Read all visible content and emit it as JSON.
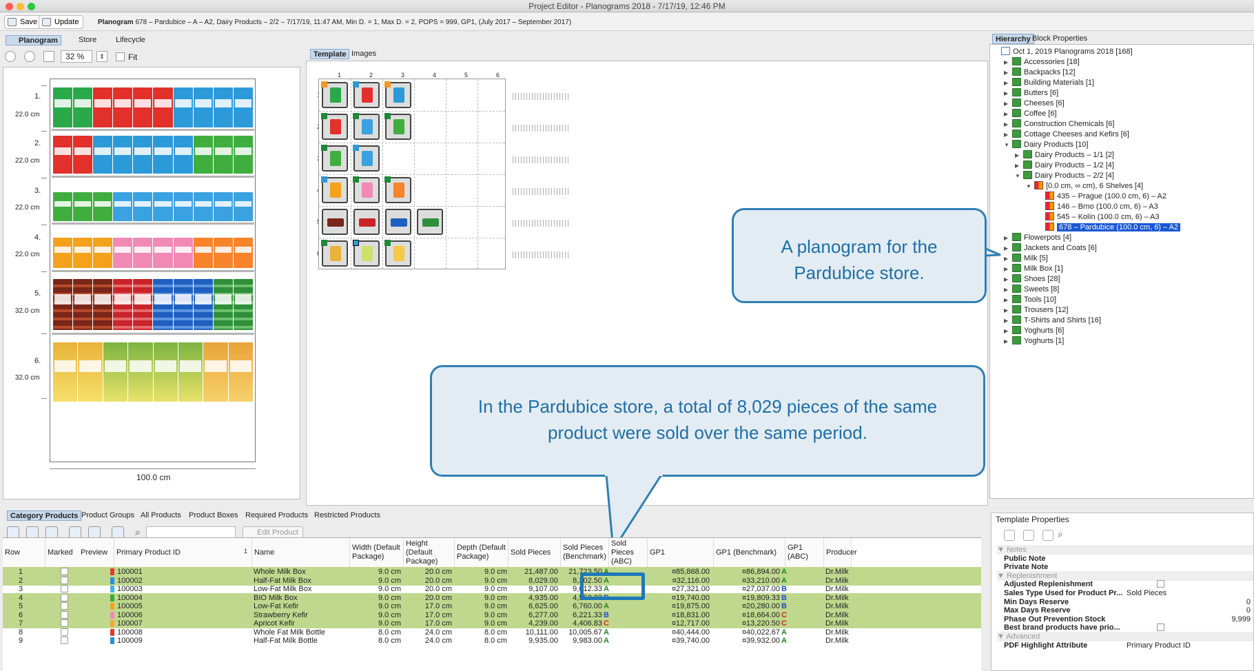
{
  "window": {
    "title": "Project Editor - Planograms 2018 - 7/17/19, 12:46 PM"
  },
  "toolbar": {
    "save_label": "Save",
    "update_label": "Update",
    "info_prefix": "Planogram",
    "info_text": "678 – Pardubice – A – A2, Dairy Products – 2/2 – 7/17/19, 11:47 AM, Min D. = 1, Max D. = 2, POPS = 999, GP1, (July 2017 – September 2017)"
  },
  "left_tabs": [
    "Planogram",
    "Store",
    "Lifecycle"
  ],
  "zoom": {
    "value": "32 %",
    "fit_label": "Fit"
  },
  "planogram": {
    "shelves": [
      {
        "num": "1.",
        "height": "22.0 cm"
      },
      {
        "num": "2.",
        "height": "22.0 cm"
      },
      {
        "num": "3.",
        "height": "22.0 cm"
      },
      {
        "num": "4.",
        "height": "22.0 cm"
      },
      {
        "num": "5.",
        "height": "32.0 cm"
      },
      {
        "num": "6.",
        "height": "32.0 cm"
      }
    ],
    "width_label": "100.0 cm"
  },
  "template_tabs": [
    "Template",
    "Images"
  ],
  "template_grid": {
    "cols": [
      "1",
      "2",
      "3",
      "4",
      "5",
      "6"
    ],
    "rows": [
      "1",
      "2",
      "3",
      "4",
      "5",
      "6"
    ]
  },
  "hierarchy_tabs": [
    "Hierarchy",
    "Block Properties"
  ],
  "tree": [
    {
      "label": "Oct 1, 2019 Planograms 2018 [168]",
      "level": 0,
      "type": "root"
    },
    {
      "label": "Accessories [18]",
      "level": 1,
      "type": "folder"
    },
    {
      "label": "Backpacks [12]",
      "level": 1,
      "type": "folder"
    },
    {
      "label": "Building Materials [1]",
      "level": 1,
      "type": "folder"
    },
    {
      "label": "Butters [6]",
      "level": 1,
      "type": "folder"
    },
    {
      "label": "Cheeses [6]",
      "level": 1,
      "type": "folder"
    },
    {
      "label": "Coffee [6]",
      "level": 1,
      "type": "folder"
    },
    {
      "label": "Construction Chemicals [6]",
      "level": 1,
      "type": "folder"
    },
    {
      "label": "Cottage Cheeses and Kefirs [6]",
      "level": 1,
      "type": "folder"
    },
    {
      "label": "Dairy Products [10]",
      "level": 1,
      "type": "folder",
      "open": true
    },
    {
      "label": "Dairy Products – 1/1 [2]",
      "level": 2,
      "type": "folder"
    },
    {
      "label": "Dairy Products – 1/2 [4]",
      "level": 2,
      "type": "folder"
    },
    {
      "label": "Dairy Products – 2/2 [4]",
      "level": 2,
      "type": "folder",
      "open": true
    },
    {
      "label": "[0.0 cm, ∞ cm), 6 Shelves [4]",
      "level": 3,
      "type": "plano",
      "open": true
    },
    {
      "label": "435 – Prague (100.0 cm, 6) – A2",
      "level": 4,
      "type": "plano"
    },
    {
      "label": "146 – Brno (100.0 cm, 6) – A3",
      "level": 4,
      "type": "plano"
    },
    {
      "label": "545 – Kolín (100.0 cm, 6) – A3",
      "level": 4,
      "type": "plano"
    },
    {
      "label": "678 – Pardubice  (100.0 cm, 6) – A2",
      "level": 4,
      "type": "plano",
      "selected": true
    },
    {
      "label": "Flowerpots [4]",
      "level": 1,
      "type": "folder"
    },
    {
      "label": "Jackets and Coats [6]",
      "level": 1,
      "type": "folder"
    },
    {
      "label": "Milk [5]",
      "level": 1,
      "type": "folder"
    },
    {
      "label": "Milk Box [1]",
      "level": 1,
      "type": "folder"
    },
    {
      "label": "Shoes [28]",
      "level": 1,
      "type": "folder"
    },
    {
      "label": "Sweets [8]",
      "level": 1,
      "type": "folder"
    },
    {
      "label": "Tools [10]",
      "level": 1,
      "type": "folder"
    },
    {
      "label": "Trousers [12]",
      "level": 1,
      "type": "folder"
    },
    {
      "label": "T-Shirts and Shirts [16]",
      "level": 1,
      "type": "folder"
    },
    {
      "label": "Yoghurts [6]",
      "level": 1,
      "type": "folder"
    },
    {
      "label": "Yoghurts [1]",
      "level": 1,
      "type": "folder"
    }
  ],
  "callouts": {
    "top": "A planogram for the Pardubice store.",
    "bottom": "In the Pardubice store, a total of 8,029 pieces of the same product were sold over the same period."
  },
  "bottom_tabs": [
    "Category Products",
    "Product Groups",
    "All Products",
    "Product Boxes",
    "Required Products",
    "Restricted Products"
  ],
  "edit_product_label": "Edit Product",
  "table": {
    "sort_indicator": "1",
    "headers": [
      "Row",
      "Marked",
      "Preview",
      "Primary Product ID",
      "Name",
      "Width (Default Package)",
      "Height (Default Package)",
      "Depth (Default Package)",
      "Sold Pieces",
      "Sold Pieces (Benchmark)",
      "Sold Pieces (ABC)",
      "GP1",
      "GP1 (Benchmark)",
      "GP1 (ABC)",
      "Producer"
    ],
    "rows": [
      {
        "row": "1",
        "id": "100001",
        "name": "Whole Milk Box",
        "w": "9.0 cm",
        "h": "20.0 cm",
        "d": "9.0 cm",
        "sold": "21,487.00",
        "bench": "21,723.50",
        "abc": "A",
        "gp1": "¤85,868.00",
        "gp1b": "¤86,894.00",
        "gabc": "A",
        "prod": "Dr.Milk",
        "color": "#e23b2a",
        "green": true
      },
      {
        "row": "2",
        "id": "100002",
        "name": "Half-Fat Milk Box",
        "w": "9.0 cm",
        "h": "20.0 cm",
        "d": "9.0 cm",
        "sold": "8,029.00",
        "bench": "8,302.50",
        "abc": "A",
        "gp1": "¤32,116.00",
        "gp1b": "¤33,210.00",
        "gabc": "A",
        "prod": "Dr.Milk",
        "color": "#2c8fd6",
        "green": true
      },
      {
        "row": "3",
        "id": "100003",
        "name": "Low-Fat Milk Box",
        "w": "9.0 cm",
        "h": "20.0 cm",
        "d": "9.0 cm",
        "sold": "9,107.00",
        "bench": "9,012.33",
        "abc": "A",
        "gp1": "¤27,321.00",
        "gp1b": "¤27,037.00",
        "gabc": "B",
        "prod": "Dr.Milk",
        "color": "#45b0e6",
        "green": false
      },
      {
        "row": "4",
        "id": "100004",
        "name": "BIO Milk Box",
        "w": "9.0 cm",
        "h": "20.0 cm",
        "d": "9.0 cm",
        "sold": "4,935.00",
        "bench": "4,952.33",
        "abc": "B",
        "gp1": "¤19,740.00",
        "gp1b": "¤19,809.33",
        "gabc": "B",
        "prod": "Dr.Milk",
        "color": "#3aa83a",
        "green": true
      },
      {
        "row": "5",
        "id": "100005",
        "name": "Low-Fat Kefir",
        "w": "9.0 cm",
        "h": "17.0 cm",
        "d": "9.0 cm",
        "sold": "6,625.00",
        "bench": "6,760.00",
        "abc": "A",
        "gp1": "¤19,875.00",
        "gp1b": "¤20,280.00",
        "gabc": "B",
        "prod": "Dr.Milk",
        "color": "#f4a21c",
        "green": true
      },
      {
        "row": "6",
        "id": "100006",
        "name": "Strawberry Kefir",
        "w": "9.0 cm",
        "h": "17.0 cm",
        "d": "9.0 cm",
        "sold": "6,277.00",
        "bench": "6,221.33",
        "abc": "B",
        "gp1": "¤18,831.00",
        "gp1b": "¤18,664.00",
        "gabc": "C",
        "prod": "Dr.Milk",
        "color": "#f08ab4",
        "green": true
      },
      {
        "row": "7",
        "id": "100007",
        "name": "Apricot Kefir",
        "w": "9.0 cm",
        "h": "17.0 cm",
        "d": "9.0 cm",
        "sold": "4,239.00",
        "bench": "4,406.83",
        "abc": "C",
        "gp1": "¤12,717.00",
        "gp1b": "¤13,220.50",
        "gabc": "C",
        "prod": "Dr.Milk",
        "color": "#f7a33a",
        "green": true
      },
      {
        "row": "8",
        "id": "100008",
        "name": "Whole Fat Milk Bottle",
        "w": "8.0 cm",
        "h": "24.0 cm",
        "d": "8.0 cm",
        "sold": "10,111.00",
        "bench": "10,005.67",
        "abc": "A",
        "gp1": "¤40,444.00",
        "gp1b": "¤40,022.67",
        "gabc": "A",
        "prod": "Dr.Milk",
        "color": "#e23b2a",
        "green": false
      },
      {
        "row": "9",
        "id": "100009",
        "name": "Half-Fat Milk Bottle",
        "w": "8.0 cm",
        "h": "24.0 cm",
        "d": "8.0 cm",
        "sold": "9,935.00",
        "bench": "9,983.00",
        "abc": "A",
        "gp1": "¤39,740.00",
        "gp1b": "¤39,932.00",
        "gabc": "A",
        "prod": "Dr.Milk",
        "color": "#2c8fd6",
        "green": false
      }
    ]
  },
  "template_props": {
    "title": "Template Properties",
    "rows": [
      {
        "section": "Notes"
      },
      {
        "key": "Public Note",
        "value": ""
      },
      {
        "key": "Private Note",
        "value": ""
      },
      {
        "section": "Replenishment"
      },
      {
        "key": "Adjusted Replenishment",
        "value": "",
        "checkbox": true
      },
      {
        "key": "Sales Type Used for Product Pr...",
        "value": "Sold Pieces"
      },
      {
        "key": "Min Days Reserve",
        "value": "0",
        "right": true
      },
      {
        "key": "Max Days Reserve",
        "value": "0",
        "right": true
      },
      {
        "key": "Phase Out Prevention Stock",
        "value": "9,999",
        "right": true
      },
      {
        "key": "Best brand products have prio...",
        "value": "",
        "checkbox": true
      },
      {
        "section": "Advanced"
      },
      {
        "key": "PDF Highlight Attribute",
        "value": "Primary Product ID"
      }
    ]
  }
}
